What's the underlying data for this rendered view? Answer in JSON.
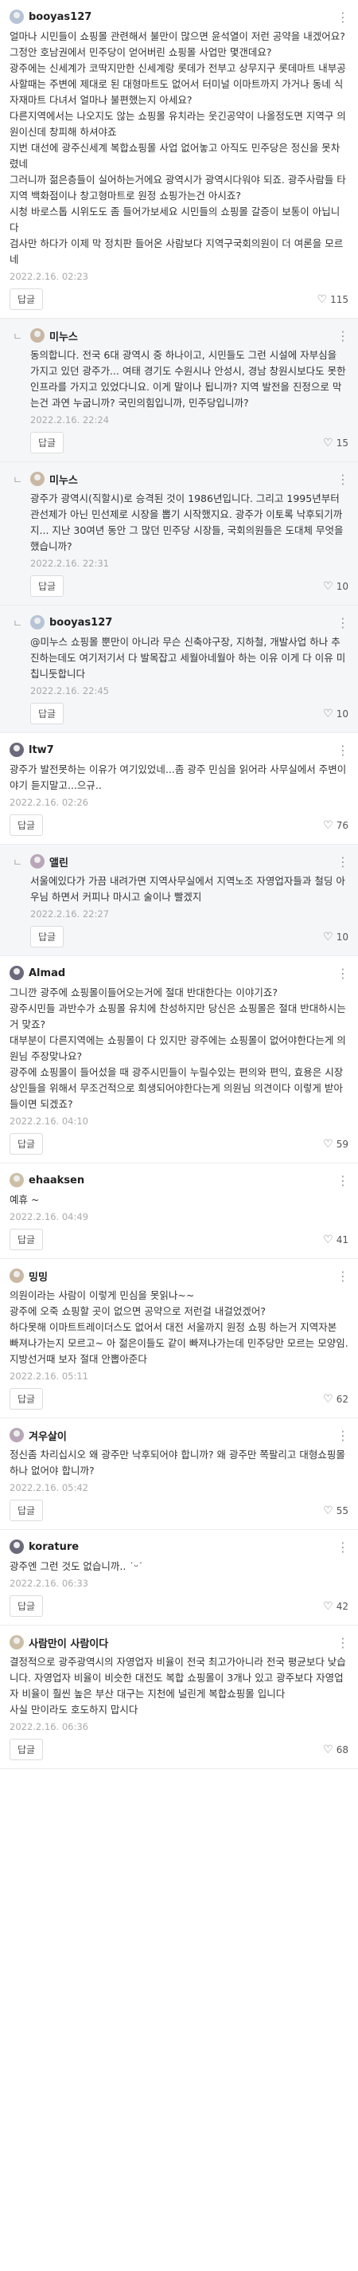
{
  "ui": {
    "reply_label": "답글",
    "heart_glyph": "♡",
    "more_glyph": "⋮"
  },
  "comments": [
    {
      "nick": "booyas127",
      "reply": false,
      "avatar": "img1",
      "text": "얼마나 시민들이 쇼핑몰 관련해서 불만이 많으면 윤석열이 저런 공약을 내겠어요?\n그정안 호남권에서 민주당이 얻어버린 쇼핑몰 사업만 몇갠데요?\n광주에는 신세계가 코딱지만한 신세계랑 롯데가 전부고 상무지구 롯데마트 내부공사할때는 주변에 제대로 된 대형마트도 없어서 터미널 이마트까지 가거나 동네 식자재마트 다녀서 얼마나 불편했는지 아세요?\n다른지역에서는 나오지도 않는 쇼핑몰 유치라는 웃긴공약이 나올정도면 지역구 의원이신데 창피해 하셔야죠\n지번 대선에 광주신세계 복합쇼핑몰 사업 없어놓고 아직도 민주당은 정신을 못차렸네\n그러니까 젊은층들이 실어하는거에요 광역시가 광역시다워야 되죠. 광주사람들 타지역 백화점이나 창고형마트로 원정 쇼핑가는건 아시죠?\n시청 바로스톱 시위도도 좀 들어가보세요 시민들의 쇼핑몰 갈증이 보통이 아닙니다\n검사만 하다가 이제 막 정치판 들어온 사람보다 지역구국회의원이 더 여론을 모르네",
      "date": "2022.2.16. 02:23",
      "likes": "115"
    },
    {
      "nick": "미누스",
      "reply": true,
      "avatar": "img2",
      "text": "동의합니다. 전국 6대 광역시 중 하나이고, 시민들도 그런 시설에 자부심을 가지고 있던 광주가... 여태 경기도 수원시나 안성시, 경남 창원시보다도 못한 인프라를 가지고 있었다니요. 이게 말이나 됩니까? 지역 발전을 진정으로 막는건 과연 누굽니까? 국민의힘입니까, 민주당입니까?",
      "date": "2022.2.16. 22:24",
      "likes": "15"
    },
    {
      "nick": "미누스",
      "reply": true,
      "avatar": "img2",
      "text": "광주가 광역시(직할시)로 승격된 것이 1986년입니다. 그리고 1995년부터 관선제가 아닌 민선제로 시장을 뽑기 시작했지요. 광주가 이토록 낙후되기까지... 지난 30여년 동안 그 많던 민주당 시장들, 국회의원들은 도대체 무엇을 했습니까?",
      "date": "2022.2.16. 22:31",
      "likes": "10"
    },
    {
      "nick": "booyas127",
      "reply": true,
      "avatar": "img1",
      "text": "@미누스 쇼핑몰 뿐만이 아니라 무슨 신축야구장, 지하철, 개발사업 하나 추진하는데도 여기저기서 다 발목잡고 세월아네월아 하는 이유 이게 다 이유 미칩니둣합니다",
      "date": "2022.2.16. 22:45",
      "likes": "10"
    },
    {
      "nick": "ltw7",
      "reply": false,
      "avatar": "img3",
      "text": "광주가 발전못하는 이유가 여기있었네...좀 광주 민심을 읽어라 사무실에서 주변이야기 듣지말고...으규..",
      "date": "2022.2.16. 02:26",
      "likes": "76"
    },
    {
      "nick": "앨린",
      "reply": true,
      "avatar": "img4",
      "text": "서울에있다가 가끔 내려가면 지역사무실에서 지역노조 자영업자들과 철딩 아우님 하면서 커피나 마시고 술이나 빨겠지",
      "date": "2022.2.16. 22:27",
      "likes": "10"
    },
    {
      "nick": "Almad",
      "reply": false,
      "avatar": "img3",
      "text": "그니깐 광주에 쇼핑몰이들어오는거에 절대 반대한다는 이야기죠?\n광주시민들 과반수가 쇼핑몰 유치에 찬성하지만 당신은 쇼핑몰은 절대 반대하시는거 맞죠?\n대부분이 다른지역에는 쇼핑몰이 다 있지만 광주에는 쇼핑몰이 없어야한다는게 의원님 주장맞나요?\n광주에 쇼핑몰이 들어섰을 때 광주시민들이 누릴수있는 편의와 편익, 효용은 시장상인들을 위해서 무조건적으로 희생되어야한다는게 의원님 의견이다 이렇게 받아들이면 되겠죠?",
      "date": "2022.2.16. 04:10",
      "likes": "59"
    },
    {
      "nick": "ehaaksen",
      "reply": false,
      "avatar": "img5",
      "text": "예휴 ~",
      "date": "2022.2.16. 04:49",
      "likes": "41"
    },
    {
      "nick": "밍밍",
      "reply": false,
      "avatar": "img2",
      "text": "의원이라는 사람이 이렇게 민심을 못읽나~~\n광주에 오죽 쇼핑할 곳이 없으면 공약으로 저런걸 내걸었겠어?\n하다못해 이마트트레이더스도 없어서 대전 서울까지 원정 쇼핑 하는거 지역자본 빠져나가는지 모르고~ 아 젊은이들도 같이 빠져나가는데 민주당만 모르는 모양임. 지방선거때 보자 절대 안뽑아준다",
      "date": "2022.2.16. 05:11",
      "likes": "62"
    },
    {
      "nick": "겨우살이",
      "reply": false,
      "avatar": "img4",
      "text": "정신좀 차리십시오 왜 광주만 낙후되어야 합니까? 왜 광주만 쪽팔리고 대형쇼핑몰 하나 없어야 합니까?",
      "date": "2022.2.16. 05:42",
      "likes": "55"
    },
    {
      "nick": "korature",
      "reply": false,
      "avatar": "img3",
      "text": "광주엔 그런 것도 없습니까.. ˙ᵕ˙",
      "date": "2022.2.16. 06:33",
      "likes": "42"
    },
    {
      "nick": "사람만이 사람이다",
      "reply": false,
      "avatar": "img5",
      "text": "결정적으로 광주광역시의 자영업자 비율이 전국 최고가아니라 전국 평균보다 낮습니다. 자영업자 비율이 비슷한 대전도 복합 쇼핑몰이 3개나 있고 광주보다 자영업자 비율이 훨씬 높은 부산 대구는 지천에 널린게 복합쇼핑몰 입니다\n사실 만이라도 호도하지 맙시다",
      "date": "2022.2.16. 06:36",
      "likes": "68"
    }
  ]
}
